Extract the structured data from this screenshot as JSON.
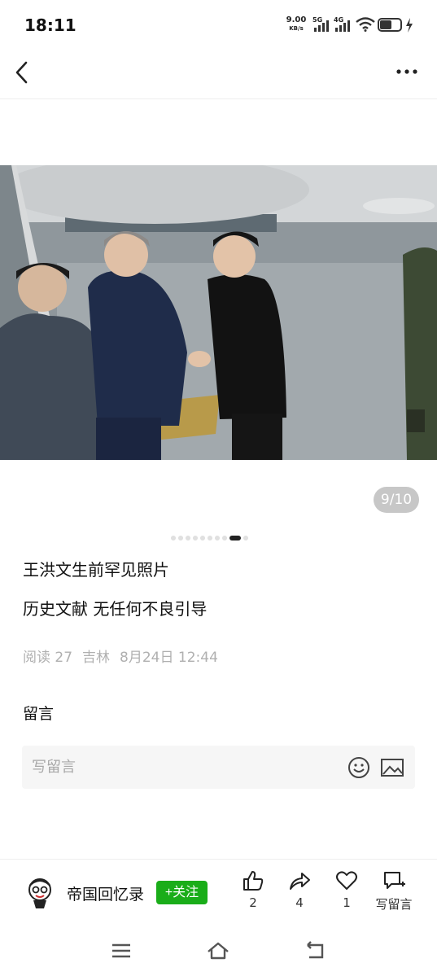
{
  "status_bar": {
    "time": "18:11",
    "net_speed_value": "9.00",
    "net_speed_unit": "KB/s",
    "signal_1": "5G",
    "signal_2": "4G",
    "battery_icon": "battery-icon",
    "charging_icon": "bolt-icon"
  },
  "nav": {
    "back_icon": "chevron-left-icon",
    "more_icon": "more-dots-icon"
  },
  "gallery": {
    "counter": "9/10",
    "current": 9,
    "total": 10
  },
  "article": {
    "title": "王洪文生前罕见照片",
    "subtitle": "历史文献 无任何不良引导",
    "reads": "阅读 27",
    "location": "吉林",
    "date": "8月24日 12:44"
  },
  "comments": {
    "heading": "留言",
    "placeholder": "写留言",
    "emoji_icon": "emoji-icon",
    "image_icon": "image-icon"
  },
  "bottom_bar": {
    "author": "帝国回忆录",
    "follow_label": "+关注",
    "follow_color": "#1aad19",
    "like_count": "2",
    "share_count": "4",
    "favorite_count": "1",
    "write_comment_label": "写留言"
  },
  "system_nav": {
    "menu_icon": "menu-icon",
    "home_icon": "home-icon",
    "back_icon": "back-icon"
  }
}
